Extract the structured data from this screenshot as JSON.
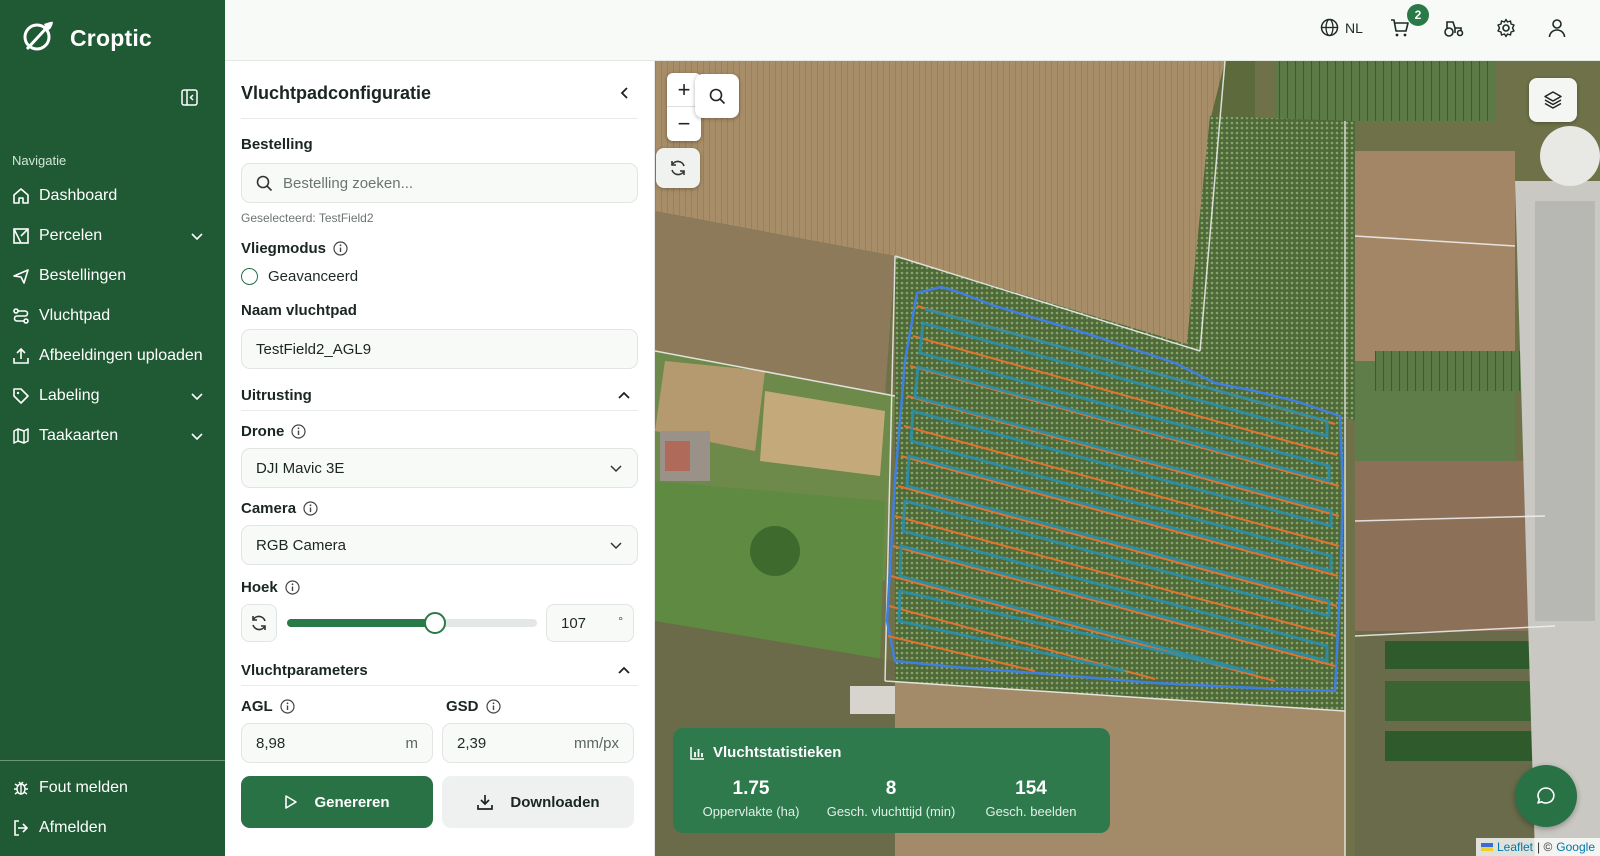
{
  "app": {
    "name": "Croptic"
  },
  "sidebar": {
    "heading": "Navigatie",
    "items": [
      {
        "label": "Dashboard",
        "icon": "home-icon"
      },
      {
        "label": "Percelen",
        "icon": "map-field-icon",
        "expandable": true
      },
      {
        "label": "Bestellingen",
        "icon": "plane-icon"
      },
      {
        "label": "Vluchtpad",
        "icon": "route-icon"
      },
      {
        "label": "Afbeeldingen uploaden",
        "icon": "upload-icon"
      },
      {
        "label": "Labeling",
        "icon": "tag-icon",
        "expandable": true
      },
      {
        "label": "Taakaarten",
        "icon": "map-icon",
        "expandable": true
      }
    ],
    "bottom": [
      {
        "label": "Fout melden",
        "icon": "bug-icon"
      },
      {
        "label": "Afmelden",
        "icon": "logout-icon"
      }
    ]
  },
  "topbar": {
    "language": "NL",
    "cart_count": "2"
  },
  "panel": {
    "title": "Vluchtpadconfiguratie",
    "order_label": "Bestelling",
    "order_search_placeholder": "Bestelling zoeken...",
    "selected_note": "Geselecteerd: TestField2",
    "flight_mode_label": "Vliegmodus",
    "flight_mode_option": "Geavanceerd",
    "path_name_label": "Naam vluchtpad",
    "path_name_value": "TestField2_AGL9",
    "equipment_label": "Uitrusting",
    "drone_label": "Drone",
    "drone_value": "DJI Mavic 3E",
    "camera_label": "Camera",
    "camera_value": "RGB Camera",
    "angle_label": "Hoek",
    "angle_value": "107",
    "angle_unit": "°",
    "angle_fraction": 0.59,
    "flight_params_label": "Vluchtparameters",
    "agl_label": "AGL",
    "agl_value": "8,98",
    "agl_unit": "m",
    "gsd_label": "GSD",
    "gsd_value": "2,39",
    "gsd_unit": "mm/px",
    "generate_label": "Genereren",
    "download_label": "Downloaden"
  },
  "stats": {
    "title": "Vluchtstatistieken",
    "items": [
      {
        "value": "1.75",
        "label": "Oppervlakte (ha)"
      },
      {
        "value": "8",
        "label": "Gesch. vluchttijd (min)"
      },
      {
        "value": "154",
        "label": "Gesch. beelden"
      }
    ]
  },
  "map": {
    "attribution_leaflet": "Leaflet",
    "attribution_sep": "| ©",
    "attribution_google": "Google"
  },
  "colors": {
    "sidebar": "#1f5a34",
    "accent": "#287246",
    "route_blue": "#3f7fe0",
    "route_orange": "#e8742f"
  }
}
